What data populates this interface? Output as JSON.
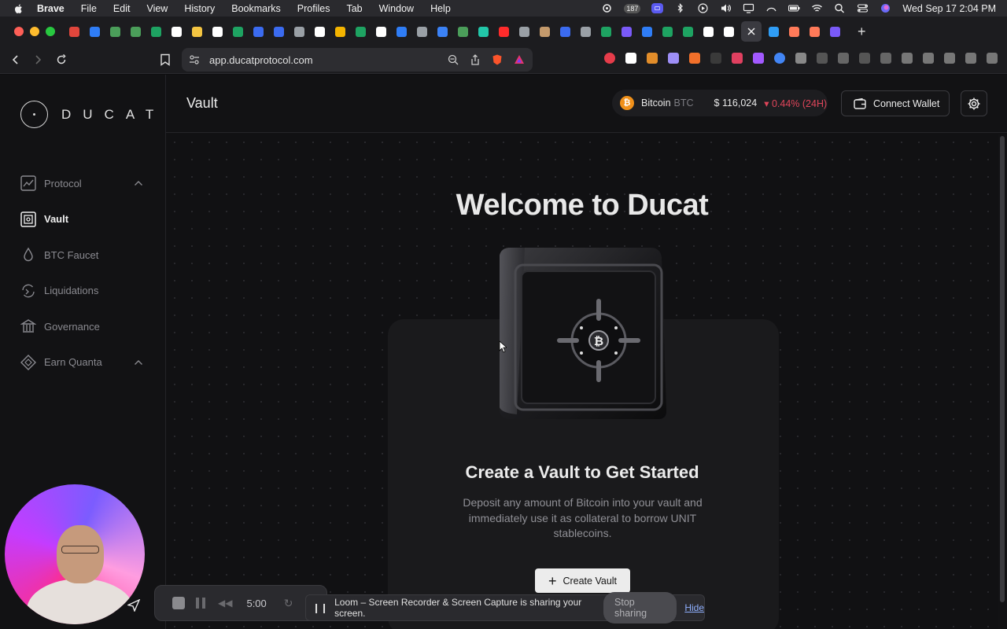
{
  "menubar": {
    "app": "Brave",
    "items": [
      "File",
      "Edit",
      "View",
      "History",
      "Bookmarks",
      "Profiles",
      "Tab",
      "Window",
      "Help"
    ],
    "badge_count": "187",
    "clock": "Wed Sep 17  2:04 PM"
  },
  "browser": {
    "url": "app.ducatprotocol.com",
    "tab_colors": [
      "#e0463c",
      "#2f7df6",
      "#4b9e5a",
      "#4b9e5a",
      "#1ea362",
      "#ffffff",
      "#f4c542",
      "#ffffff",
      "#1ea362",
      "#3b6bf0",
      "#3b6bf0",
      "#9aa0a6",
      "#ffffff",
      "#f4b400",
      "#1ea362",
      "#ffffff",
      "#2f7df6",
      "#9aa0a6",
      "#3b82f6",
      "#4b9e5a",
      "#22c7a9",
      "#ff2b2b",
      "#9aa0a6",
      "#c49a6c",
      "#3b6bf0",
      "#9aa0a6",
      "#1ea362",
      "#7a5af8",
      "#2f7df6",
      "#1ea362",
      "#1ea362",
      "#ffffff",
      "#ffffff",
      "#2f9df5",
      "#ff7a59",
      "#ff7a59",
      "#7a5af8"
    ],
    "new_tab": "+"
  },
  "brand": {
    "name": "DUCAT"
  },
  "sidebar": {
    "items": [
      {
        "label": "Protocol",
        "icon": "chart-line-icon"
      },
      {
        "label": "Vault",
        "icon": "vault-icon"
      },
      {
        "label": "BTC Faucet",
        "icon": "drop-icon"
      },
      {
        "label": "Liquidations",
        "icon": "swap-icon"
      },
      {
        "label": "Governance",
        "icon": "bank-icon"
      },
      {
        "label": "Earn Quanta",
        "icon": "diamond-icon"
      }
    ]
  },
  "header": {
    "title": "Vault",
    "coin_name": "Bitcoin",
    "coin_symbol": "BTC",
    "price": "$ 116,024",
    "change": "0.44% (24H)",
    "connect_label": "Connect Wallet"
  },
  "main": {
    "welcome": "Welcome to Ducat",
    "card_title": "Create a Vault to Get Started",
    "card_desc": "Deposit any amount of Bitcoin into your vault and immediately use it as collateral to borrow UNIT stablecoins.",
    "create_label": "Create Vault"
  },
  "loom": {
    "timer": "5:00",
    "share_text": "Loom – Screen Recorder & Screen Capture is sharing your screen.",
    "stop_sharing": "Stop sharing",
    "hide": "Hide"
  }
}
